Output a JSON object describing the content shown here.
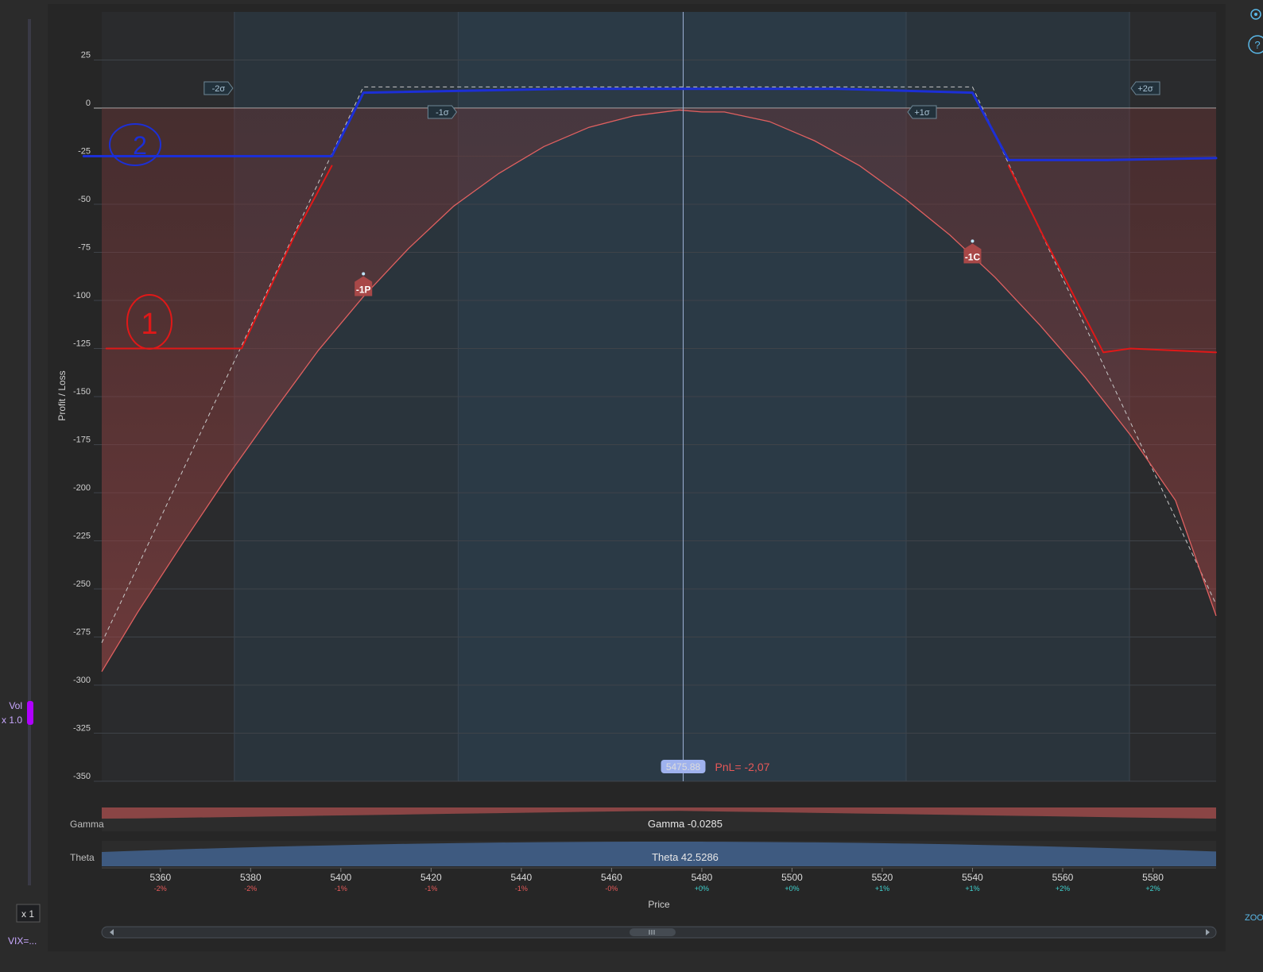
{
  "colors": {
    "background": "#2b2b2b",
    "plot_background": "#2a2d31",
    "band_2sigma": "#2a343c",
    "band_1sigma": "#2b3a46",
    "loss_fill": "#8a3a3a",
    "curve_today": "#e06060",
    "expiry_dashed": "#c8c8c8",
    "blue_annotation": "#1c2fd6",
    "red_annotation": "#e01818",
    "price_line": "#9fb3d9",
    "gamma_fill": "#8a4545",
    "theta_fill": "#3e5a80",
    "accent_purple": "#b000ff",
    "pnl_color": "#e65858"
  },
  "icons": {
    "settings": "gear-icon",
    "help": "question-icon",
    "scroll_left": "chevron-left-icon",
    "scroll_right": "chevron-right-icon",
    "scroll_thumb": "grip-icon"
  },
  "chart_data": {
    "type": "line",
    "xlabel": "Price",
    "ylabel": "Profit / Loss",
    "xlim": [
      5347,
      5594
    ],
    "ylim": [
      -350,
      50
    ],
    "x_ticks": [
      5360,
      5380,
      5400,
      5420,
      5440,
      5460,
      5480,
      5500,
      5520,
      5540,
      5560,
      5580
    ],
    "x_tick_pct": [
      "-2%",
      "-2%",
      "-1%",
      "-1%",
      "-1%",
      "-0%",
      "+0%",
      "+0%",
      "+1%",
      "+1%",
      "+2%",
      "+2%"
    ],
    "y_ticks": [
      25,
      0,
      -25,
      -50,
      -75,
      -100,
      -125,
      -150,
      -175,
      -200,
      -225,
      -250,
      -275,
      -300,
      -325,
      -350
    ],
    "grid": true,
    "sigma_bands": [
      {
        "label": "-2σ",
        "price": 5376.4
      },
      {
        "label": "-1σ",
        "price": 5426.0
      },
      {
        "label": "+1σ",
        "price": 5525.3
      },
      {
        "label": "+2σ",
        "price": 5574.8
      }
    ],
    "series": [
      {
        "x": [
          5347,
          5355,
          5365,
          5375,
          5385,
          5395,
          5405,
          5415,
          5425,
          5435,
          5445,
          5455,
          5465,
          5475,
          5480,
          5485,
          5495,
          5505,
          5515,
          5525,
          5535,
          5545,
          5555,
          5565,
          5575,
          5585,
          5594
        ],
        "y": [
          -293,
          -262,
          -226,
          -191,
          -158,
          -126,
          -98,
          -73,
          -51,
          -34,
          -20,
          -10,
          -4,
          -1,
          -2,
          -2,
          -7,
          -17,
          -30,
          -47,
          -66,
          -88,
          -113,
          -140,
          -170,
          -204,
          -264
        ]
      },
      {
        "x": [
          5347,
          5405,
          5540,
          5594
        ],
        "y": [
          -278,
          11,
          11,
          -258
        ]
      }
    ],
    "legs": [
      {
        "label": "-1P",
        "price": 5405,
        "pnl": -87
      },
      {
        "label": "-1C",
        "price": 5540,
        "pnl": -70
      }
    ],
    "current_price": "5475.88",
    "current_price_value": 5475.88,
    "pnl_label": "PnL= -2,07",
    "gamma": {
      "label": "Gamma",
      "value_text": "Gamma -0.0285"
    },
    "theta": {
      "label": "Theta",
      "value_text": "Theta 42.5286"
    },
    "annotations": {
      "blue_curve": {
        "x": [
          5343,
          5398,
          5405,
          5450,
          5480,
          5510,
          5540,
          5548,
          5570,
          5594
        ],
        "y": [
          -25,
          -25,
          8,
          10,
          10,
          10,
          8,
          -27,
          -27,
          -26
        ]
      },
      "red_left": {
        "x": [
          5348,
          5378,
          5390,
          5398
        ],
        "y": [
          -125,
          -125,
          -65,
          -30
        ]
      },
      "red_right": {
        "x": [
          5548,
          5556,
          5563,
          5569,
          5575,
          5594
        ],
        "y": [
          -30,
          -68,
          -100,
          -127,
          -125,
          -127
        ]
      },
      "label_1": "1",
      "label_2": "2"
    }
  },
  "sidebar": {
    "vol_label": "Vol",
    "vol_multiplier": "x 1.0",
    "zoom_button": "x 1",
    "vix_label": "VIX=..."
  },
  "right_edge": {
    "zoom_label": "ZOO"
  }
}
